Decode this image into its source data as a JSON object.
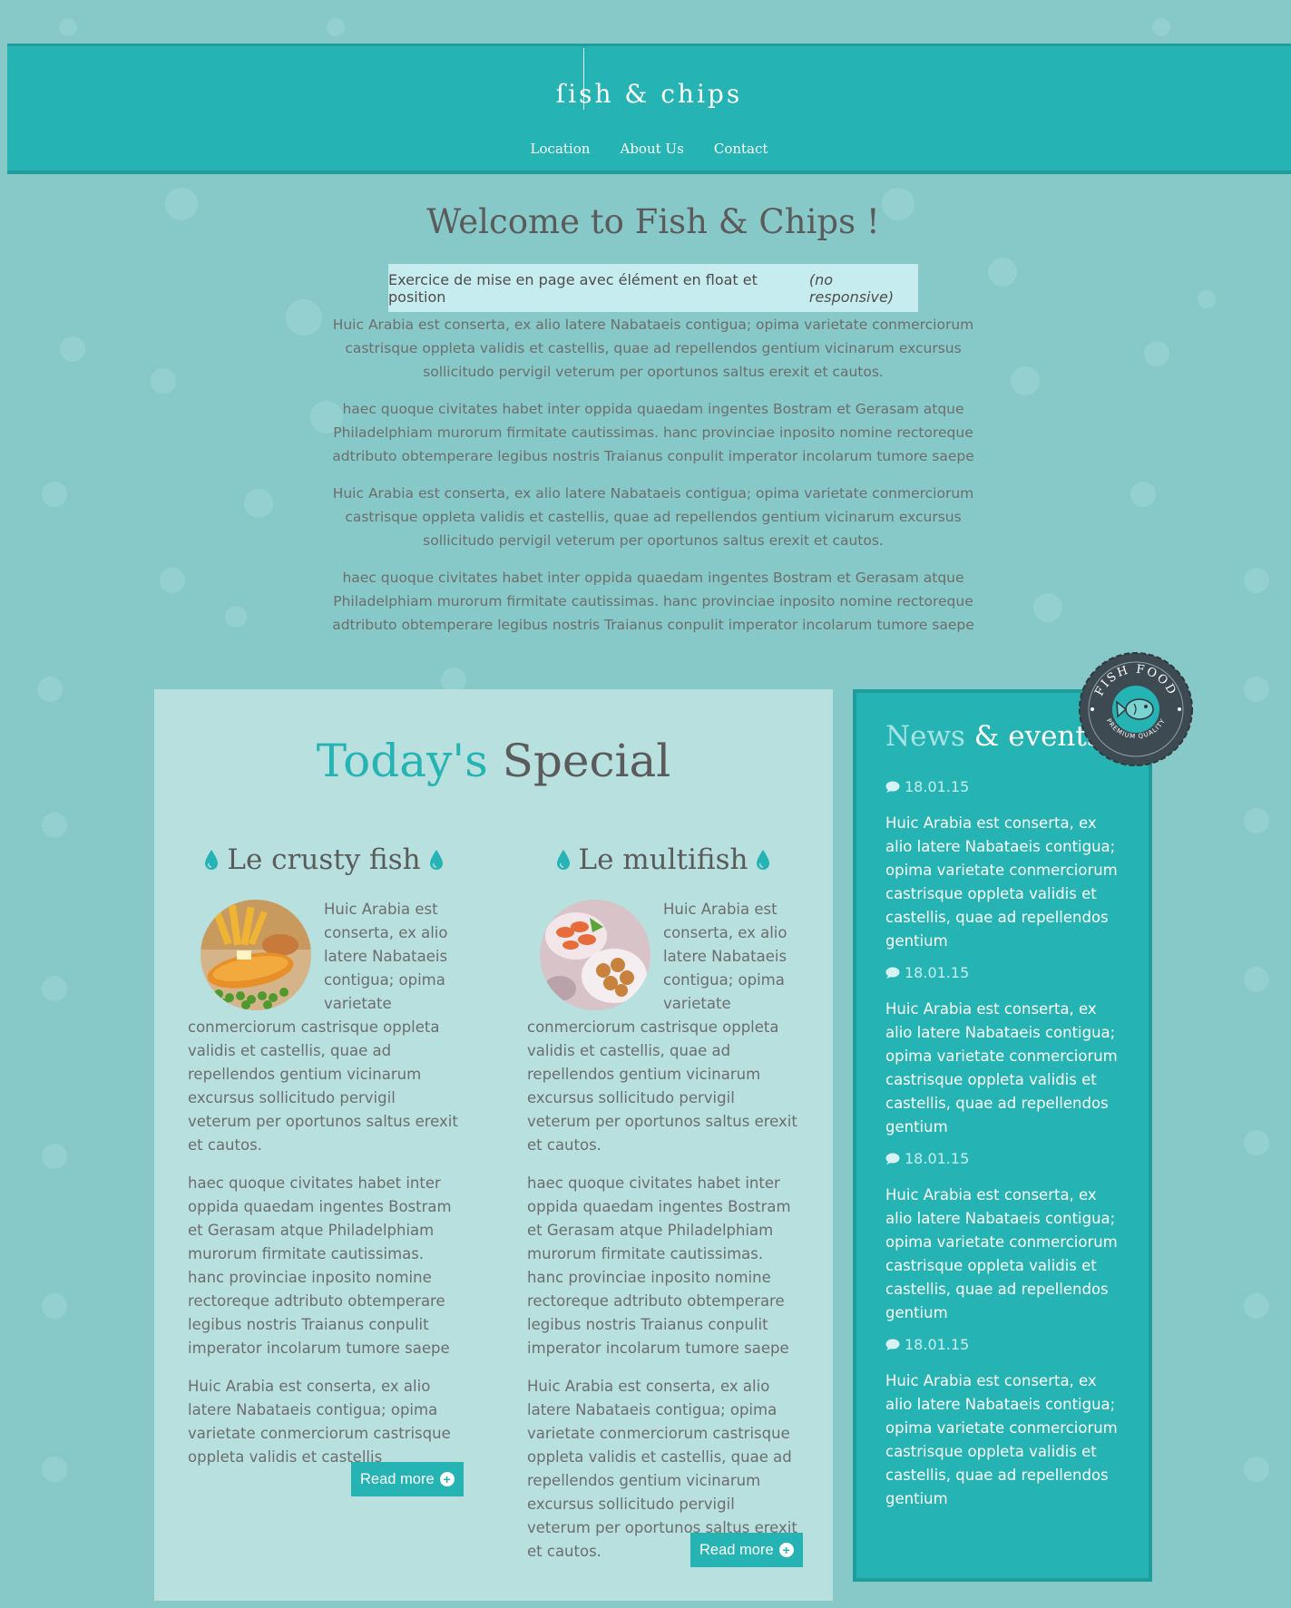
{
  "header": {
    "logo": "ſish & chips",
    "nav": [
      "Location",
      "About Us",
      "Contact"
    ]
  },
  "welcome": {
    "title": "Welcome to Fish & Chips !",
    "callout": "Exercice de mise en page avec élément en float et position",
    "callout_em": "(no responsive)",
    "paragraphs": [
      "Huic Arabia est conserta, ex alio latere Nabataeis contigua; opima varietate conmerciorum castrisque oppleta validis et castellis, quae ad repellendos gentium vicinarum excursus sollicitudo pervigil veterum per oportunos saltus erexit et cautos.",
      "haec quoque civitates habet inter oppida quaedam ingentes Bostram et Gerasam atque Philadelphiam murorum firmitate cautissimas. hanc provinciae inposito nomine rectoreque adtributo obtemperare legibus nostris Traianus conpulit imperator incolarum tumore saepe",
      "Huic Arabia est conserta, ex alio latere Nabataeis contigua; opima varietate conmerciorum castrisque oppleta validis et castellis, quae ad repellendos gentium vicinarum excursus sollicitudo pervigil veterum per oportunos saltus erexit et cautos.",
      "haec quoque civitates habet inter oppida quaedam ingentes Bostram et Gerasam atque Philadelphiam murorum firmitate cautissimas. hanc provinciae inposito nomine rectoreque adtributo obtemperare legibus nostris Traianus conpulit imperator incolarum tumore saepe"
    ]
  },
  "specials": {
    "title_accent": "Today's",
    "title_rest": " Special",
    "dishes": [
      {
        "title": "Le crusty fish",
        "paragraphs": [
          "Huic Arabia est conserta, ex alio latere Nabataeis contigua; opima varietate conmerciorum castrisque oppleta validis et castellis, quae ad repellendos gentium vicinarum excursus sollicitudo pervigil veterum per oportunos saltus erexit et cautos.",
          "haec quoque civitates habet inter oppida quaedam ingentes Bostram et Gerasam atque Philadelphiam murorum firmitate cautissimas. hanc provinciae inposito nomine rectoreque adtributo obtemperare legibus nostris Traianus conpulit imperator incolarum tumore saepe",
          "Huic Arabia est conserta, ex alio latere Nabataeis contigua; opima varietate conmerciorum castrisque oppleta validis et castellis"
        ],
        "button": "Read more"
      },
      {
        "title": "Le multifish",
        "paragraphs": [
          "Huic Arabia est conserta, ex alio latere Nabataeis contigua; opima varietate conmerciorum castrisque oppleta validis et castellis, quae ad repellendos gentium vicinarum excursus sollicitudo pervigil veterum per oportunos saltus erexit et cautos.",
          "haec quoque civitates habet inter oppida quaedam ingentes Bostram et Gerasam atque Philadelphiam murorum firmitate cautissimas. hanc provinciae inposito nomine rectoreque adtributo obtemperare legibus nostris Traianus conpulit imperator incolarum tumore saepe",
          "Huic Arabia est conserta, ex alio latere Nabataeis contigua; opima varietate conmerciorum castrisque oppleta validis et castellis, quae ad repellendos gentium vicinarum excursus sollicitudo pervigil veterum per oportunos saltus erexit et cautos."
        ],
        "button": "Read more"
      }
    ]
  },
  "news": {
    "title_muted": "News",
    "title_rest": " & events",
    "items": [
      {
        "date": "18.01.15",
        "text": "Huic Arabia est conserta, ex alio latere Nabataeis contigua; opima varietate conmerciorum castrisque oppleta validis et castellis, quae ad repellendos gentium"
      },
      {
        "date": "18.01.15",
        "text": "Huic Arabia est conserta, ex alio latere Nabataeis contigua; opima varietate conmerciorum castrisque oppleta validis et castellis, quae ad repellendos gentium"
      },
      {
        "date": "18.01.15",
        "text": "Huic Arabia est conserta, ex alio latere Nabataeis contigua; opima varietate conmerciorum castrisque oppleta validis et castellis, quae ad repellendos gentium"
      },
      {
        "date": "18.01.15",
        "text": "Huic Arabia est conserta, ex alio latere Nabataeis contigua; opima varietate conmerciorum castrisque oppleta validis et castellis, quae ad repellendos gentium"
      }
    ]
  },
  "badge": {
    "top_text": "FISH FOOD",
    "bottom_text": "PREMIUM QUALITY"
  },
  "icons": {
    "dish_title_decoration": "water-drop-icon",
    "read_more": "plus-circle-icon",
    "news_date": "speech-bubble-icon",
    "badge": "fish-icon"
  },
  "colors": {
    "background": "#87c9c8",
    "accent": "#26b3b3",
    "accent_dark": "#1f9c9c",
    "panel": "#b7e0df",
    "callout": "#c7ecef",
    "text": "#5b5b5b",
    "badge_dark": "#3e4a52"
  }
}
